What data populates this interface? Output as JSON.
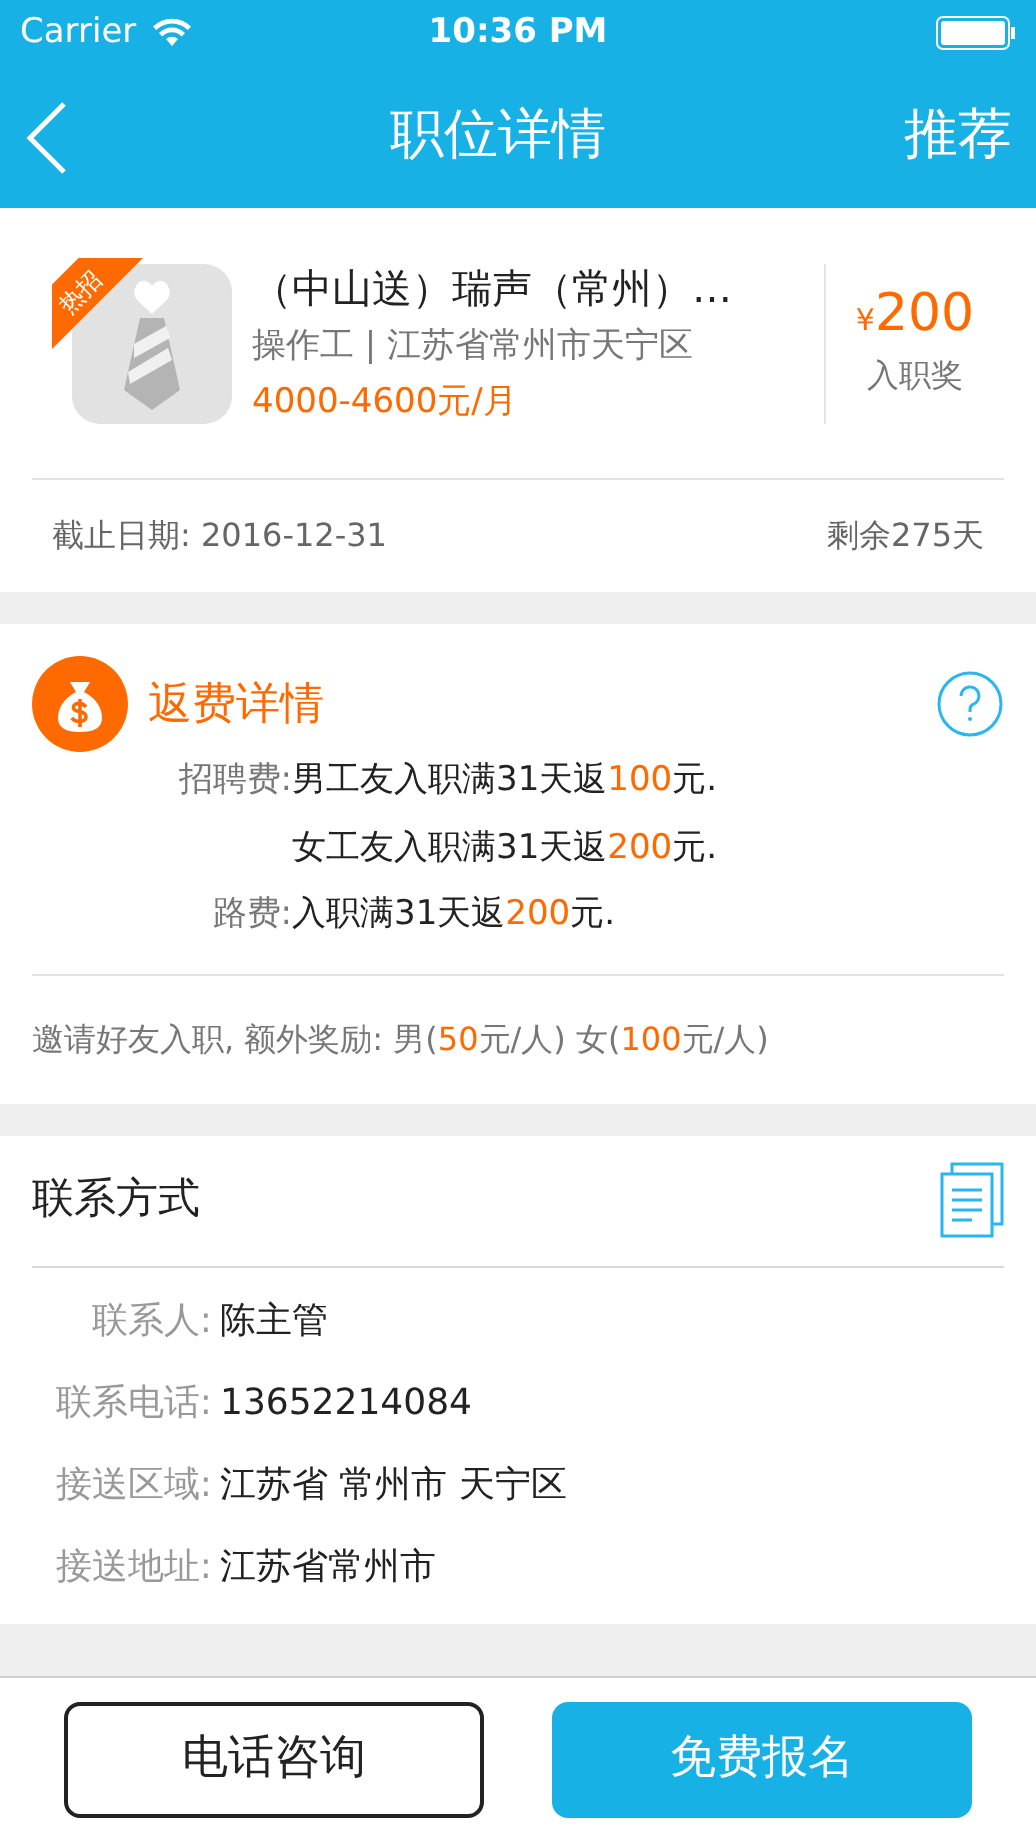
{
  "status_bar": {
    "carrier": "Carrier",
    "time": "10:36 PM"
  },
  "nav": {
    "title": "职位详情",
    "action": "推荐"
  },
  "job": {
    "badge": "热招",
    "title": "（中山送）瑞声（常州）…",
    "subtitle": "操作工 | 江苏省常州市天宁区",
    "salary": "4000-4600元/月",
    "bonus_currency": "¥",
    "bonus_amount": "200",
    "bonus_label": "入职奖",
    "deadline": "截止日期: 2016-12-31",
    "remaining": "剩余275天"
  },
  "rebate": {
    "title": "返费详情",
    "rows": [
      {
        "label": "招聘费:",
        "parts": [
          {
            "text": "男工友入职满31天返",
            "accent": false
          },
          {
            "text": "100",
            "accent": true
          },
          {
            "text": "元.",
            "accent": false
          }
        ]
      },
      {
        "label": "",
        "parts": [
          {
            "text": "女工友入职满31天返",
            "accent": false
          },
          {
            "text": "200",
            "accent": true
          },
          {
            "text": "元.",
            "accent": false
          }
        ]
      },
      {
        "label": "路费:",
        "parts": [
          {
            "text": "入职满31天返",
            "accent": false
          },
          {
            "text": "200",
            "accent": true
          },
          {
            "text": "元.",
            "accent": false
          }
        ]
      }
    ],
    "invite": [
      {
        "text": "邀请好友入职, 额外奖励: 男(",
        "accent": false
      },
      {
        "text": "50",
        "accent": true
      },
      {
        "text": "元/人) 女(",
        "accent": false
      },
      {
        "text": "100",
        "accent": true
      },
      {
        "text": "元/人)",
        "accent": false
      }
    ]
  },
  "contact": {
    "title": "联系方式",
    "rows": [
      {
        "label": "联系人:",
        "value": "陈主管"
      },
      {
        "label": "联系电话:",
        "value": "13652214084"
      },
      {
        "label": "接送区域:",
        "value": "江苏省 常州市 天宁区"
      },
      {
        "label": "接送地址:",
        "value": "江苏省常州市"
      }
    ]
  },
  "buttons": [
    {
      "label": "电话咨询",
      "kind": "outline"
    },
    {
      "label": "免费报名",
      "kind": "primary"
    }
  ]
}
